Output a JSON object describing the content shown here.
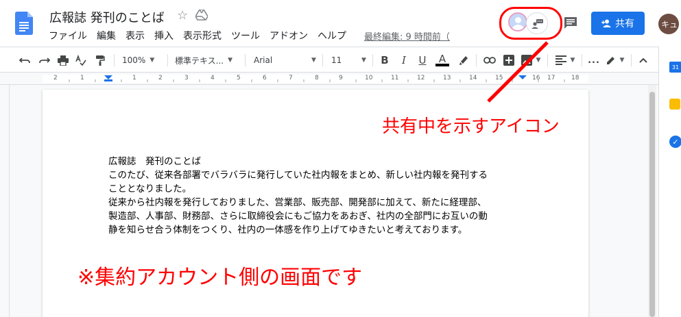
{
  "header": {
    "title": "広報誌 発刊のことば",
    "menu": [
      "ファイル",
      "編集",
      "表示",
      "挿入",
      "表示形式",
      "ツール",
      "アドオン",
      "ヘルプ"
    ],
    "last_edit": "最終編集: 9 時間前（",
    "share_label": "共有",
    "account_initials": "キュ"
  },
  "toolbar": {
    "zoom": "100%",
    "style": "標準テキス...",
    "font": "Arial",
    "font_size": "11",
    "more": "..."
  },
  "ruler": {
    "labels": [
      "2",
      "1",
      "1",
      "2",
      "3",
      "4",
      "5",
      "6",
      "7",
      "8",
      "9",
      "10",
      "11",
      "12",
      "13",
      "14",
      "15",
      "16",
      "17",
      "18"
    ]
  },
  "document": {
    "lines": [
      "広報誌　発刊のことば",
      "このたび、従来各部署でバラバラに発行していた社内報をまとめ、新しい社内報を発刊する",
      "こととなりました。",
      "従来から社内報を発行しておりました、営業部、販売部、開発部に加えて、新たに経理部、",
      "製造部、人事部、財務部、さらに取締役会にもご協力をあおぎ、社内の全部門にお互いの動",
      "静を知らせ合う体制をつくり、社内の一体感を作り上げてゆきたいと考えております。"
    ]
  },
  "annotations": {
    "sharing_callout": "共有中を示すアイコン",
    "account_note": "※集約アカウント側の画面です"
  },
  "side_panel": {
    "calendar_label": "31"
  },
  "colors": {
    "accent": "#1a73e8",
    "annotation": "#ff0000",
    "docs_blue": "#4285f4"
  }
}
